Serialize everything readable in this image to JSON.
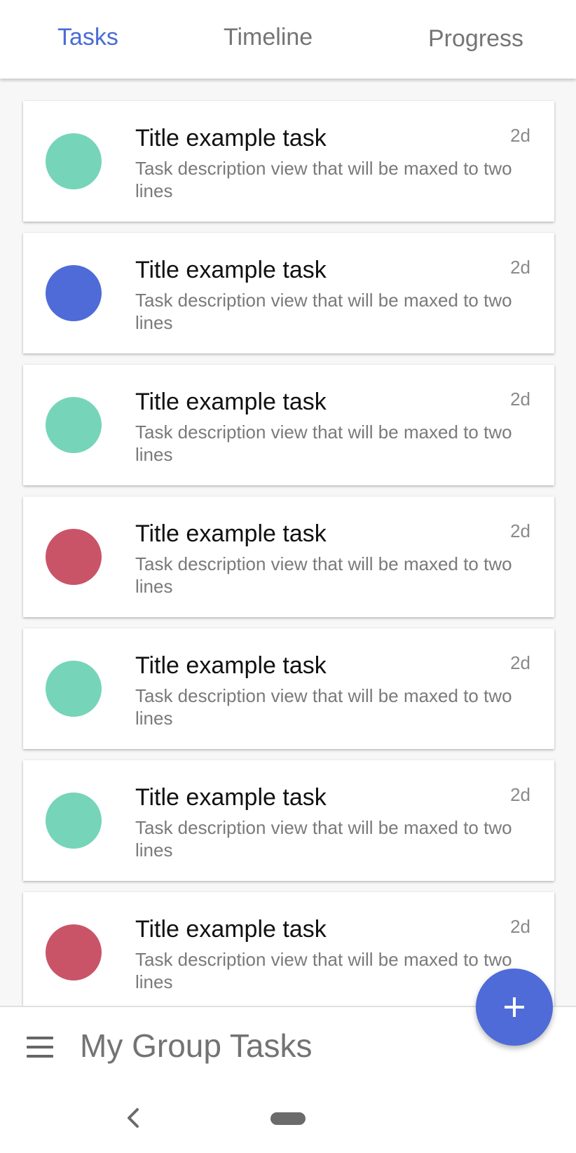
{
  "tabs": [
    {
      "label": "Tasks",
      "active": true
    },
    {
      "label": "Timeline",
      "active": false
    },
    {
      "label": "Progress",
      "active": false
    }
  ],
  "colors": {
    "accent": "#4a6bd6",
    "teal": "#76d4b9",
    "blue": "#4f6bd8",
    "red": "#c95468"
  },
  "tasks": [
    {
      "title": "Title example task",
      "description": "Task description view that will be maxed to two lines",
      "age": "2d",
      "color": "#76d4b9"
    },
    {
      "title": "Title example task",
      "description": "Task description view that will be maxed to two lines",
      "age": "2d",
      "color": "#4f6bd8"
    },
    {
      "title": "Title example task",
      "description": "Task description view that will be maxed to two lines",
      "age": "2d",
      "color": "#76d4b9"
    },
    {
      "title": "Title example task",
      "description": "Task description view that will be maxed to two lines",
      "age": "2d",
      "color": "#c95468"
    },
    {
      "title": "Title example task",
      "description": "Task description view that will be maxed to two lines",
      "age": "2d",
      "color": "#76d4b9"
    },
    {
      "title": "Title example task",
      "description": "Task description view that will be maxed to two lines",
      "age": "2d",
      "color": "#76d4b9"
    },
    {
      "title": "Title example task",
      "description": "Task description view that will be maxed to two lines",
      "age": "2d",
      "color": "#c95468"
    }
  ],
  "bottom_bar": {
    "title": "My Group Tasks",
    "menu_icon": "hamburger-menu-icon"
  },
  "fab": {
    "icon": "plus-icon"
  },
  "nav": {
    "back_icon": "back-chevron-icon",
    "home_icon": "home-pill-icon"
  }
}
